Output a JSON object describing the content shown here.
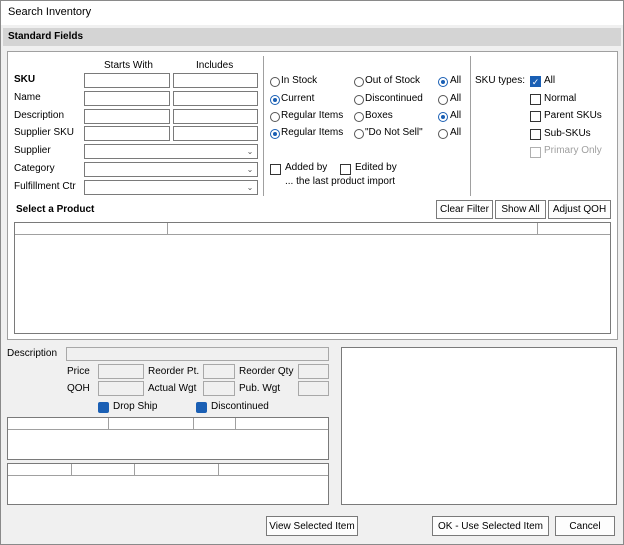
{
  "window": {
    "title": "Search Inventory"
  },
  "section": {
    "title": "Standard Fields"
  },
  "filters": {
    "col_starts_with": "Starts With",
    "col_includes": "Includes",
    "sku": "SKU",
    "name": "Name",
    "description": "Description",
    "supplier_sku": "Supplier SKU",
    "supplier": "Supplier",
    "category": "Category",
    "fulfillment": "Fulfillment Ctr"
  },
  "stock": {
    "in_stock": "In Stock",
    "out_of_stock": "Out of Stock",
    "all1": "All",
    "current": "Current",
    "discontinued": "Discontinued",
    "all2": "All",
    "regular_items": "Regular Items",
    "boxes": "Boxes",
    "all3": "All",
    "regular_items2": "Regular Items",
    "do_not_sell": "\"Do Not Sell\"",
    "all4": "All",
    "added_by": "Added by",
    "edited_by": "Edited by",
    "last_import": "... the last product import"
  },
  "sku_types": {
    "label": "SKU types:",
    "all": "All",
    "normal": "Normal",
    "parent": "Parent SKUs",
    "sub": "Sub-SKUs",
    "primary_only": "Primary Only"
  },
  "product": {
    "title": "Select a Product",
    "clear_filter": "Clear Filter",
    "show_all": "Show All",
    "adjust_qoh": "Adjust QOH"
  },
  "details": {
    "description": "Description",
    "price": "Price",
    "reorder_pt": "Reorder Pt.",
    "reorder_qty": "Reorder Qty",
    "qoh": "QOH",
    "actual_wgt": "Actual Wgt",
    "pub_wgt": "Pub. Wgt",
    "drop_ship": "Drop Ship",
    "discontinued": "Discontinued"
  },
  "footer": {
    "view_selected": "View Selected Item",
    "ok": "OK - Use Selected Item",
    "cancel": "Cancel"
  },
  "colors": {
    "accent": "#1a5fb4",
    "panel_bg": "#f0f0f0",
    "header_bg": "#d4d4d4"
  }
}
